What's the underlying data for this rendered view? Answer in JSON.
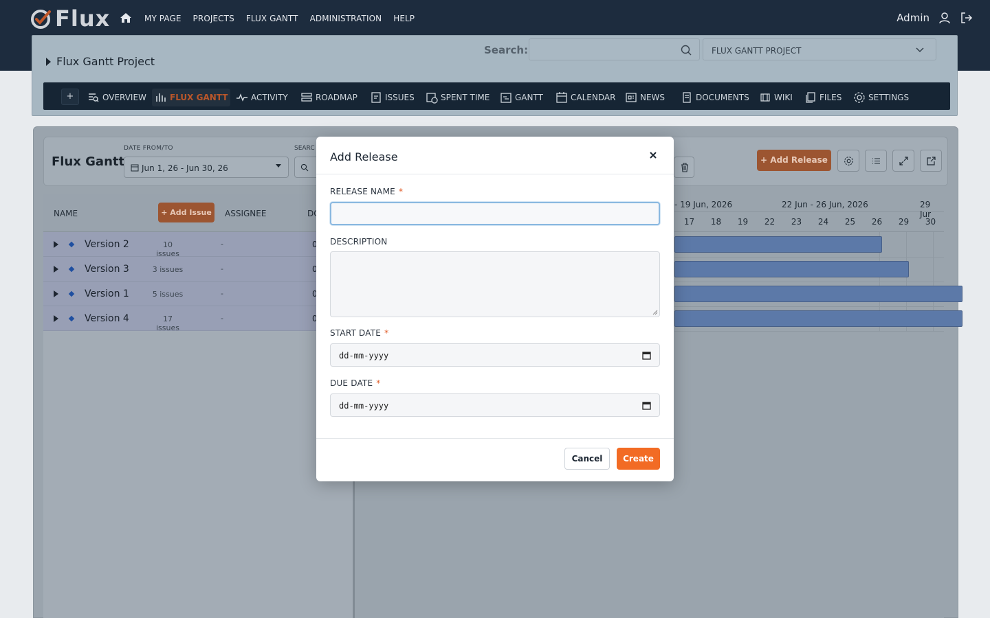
{
  "app": {
    "logo_text": "Flux",
    "nav": [
      "MY PAGE",
      "PROJECTS",
      "FLUX GANTT",
      "ADMINISTRATION",
      "HELP"
    ],
    "user": "Admin"
  },
  "project": {
    "title": "Flux Gantt Project",
    "search_label": "Search:",
    "search_value": "",
    "selected_project": "FLUX GANTT PROJECT"
  },
  "tabs": [
    {
      "label": "OVERVIEW",
      "icon": "overview-icon"
    },
    {
      "label": "FLUX GANTT",
      "icon": "flux-gantt-icon",
      "active": true
    },
    {
      "label": "ACTIVITY",
      "icon": "activity-icon"
    },
    {
      "label": "ROADMAP",
      "icon": "roadmap-icon"
    },
    {
      "label": "ISSUES",
      "icon": "issues-icon"
    },
    {
      "label": "SPENT TIME",
      "icon": "spent-time-icon"
    },
    {
      "label": "GANTT",
      "icon": "gantt-icon"
    },
    {
      "label": "CALENDAR",
      "icon": "calendar-icon"
    },
    {
      "label": "NEWS",
      "icon": "news-icon"
    },
    {
      "label": "DOCUMENTS",
      "icon": "documents-icon"
    },
    {
      "label": "WIKI",
      "icon": "wiki-icon"
    },
    {
      "label": "FILES",
      "icon": "files-icon"
    },
    {
      "label": "SETTINGS",
      "icon": "settings-icon"
    }
  ],
  "tab_plus": "+",
  "gantt": {
    "title": "Flux Gantt",
    "date_label": "DATE FROM/TO",
    "date_value": "Jun 1, 26 - Jun 30, 26",
    "search_label": "SEARC",
    "add_release": "+ Add Release",
    "columns": {
      "name": "NAME",
      "add_issue": "+ Add Issue",
      "assignee": "ASSIGNEE",
      "extra": "DC"
    },
    "rows": [
      {
        "name": "Version 2",
        "count": "10 issues",
        "assignee": "-",
        "extra": "0"
      },
      {
        "name": "Version 3",
        "count": "3 issues",
        "assignee": "-",
        "extra": "0"
      },
      {
        "name": "Version 1",
        "count": "5 issues",
        "assignee": "-",
        "extra": "0"
      },
      {
        "name": "Version 4",
        "count": "17 issues",
        "assignee": "-",
        "extra": "0"
      }
    ],
    "week_headers": [
      "- 19 Jun, 2026",
      "22 Jun - 26 Jun, 2026",
      "29 Jur"
    ],
    "days": [
      "17",
      "18",
      "19",
      "22",
      "23",
      "24",
      "25",
      "26",
      "29",
      "30"
    ]
  },
  "modal": {
    "title": "Add Release",
    "release_name_label": "RELEASE NAME",
    "release_name_value": "",
    "description_label": "DESCRIPTION",
    "description_value": "",
    "start_date_label": "START DATE",
    "start_date_placeholder": "dd-mm-yyyy",
    "due_date_label": "DUE DATE",
    "due_date_placeholder": "dd-mm-yyyy",
    "required_mark": "*",
    "cancel": "Cancel",
    "create": "Create"
  },
  "colors": {
    "topbar": "#1d2c3e",
    "accent": "#f26b24",
    "bar": "#5c79a8"
  }
}
